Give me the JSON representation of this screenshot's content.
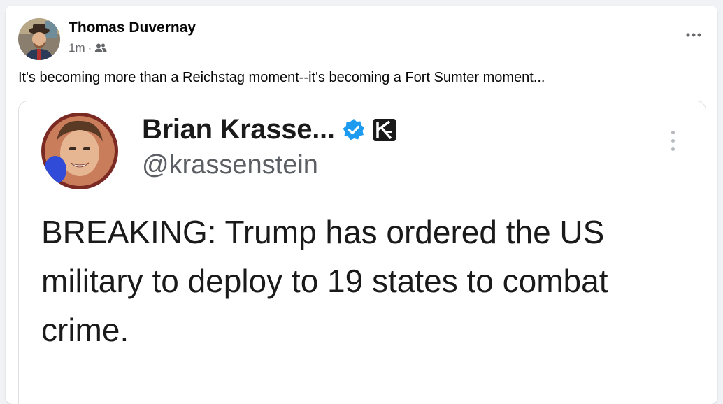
{
  "post": {
    "author_name": "Thomas Duvernay",
    "timestamp": "1m",
    "separator": "·",
    "audience_icon": "friends-icon",
    "more_icon": "more-options-icon",
    "caption": "It's becoming more than a Reichstag moment--it's becoming a Fort Sumter moment..."
  },
  "shared_tweet": {
    "display_name": "Brian Krasse...",
    "handle": "@krassenstein",
    "text": "BREAKING: Trump has ordered the US military to deploy to 19 states to combat crime.",
    "verified_icon": "verified-badge-icon",
    "extra_badge_icon": "k-badge-icon",
    "more_icon": "vertical-more-icon"
  },
  "colors": {
    "background": "#f0f2f5",
    "card": "#ffffff",
    "primary_text": "#050505",
    "secondary_text": "#65676b",
    "verified_blue": "#1d9bf0"
  }
}
